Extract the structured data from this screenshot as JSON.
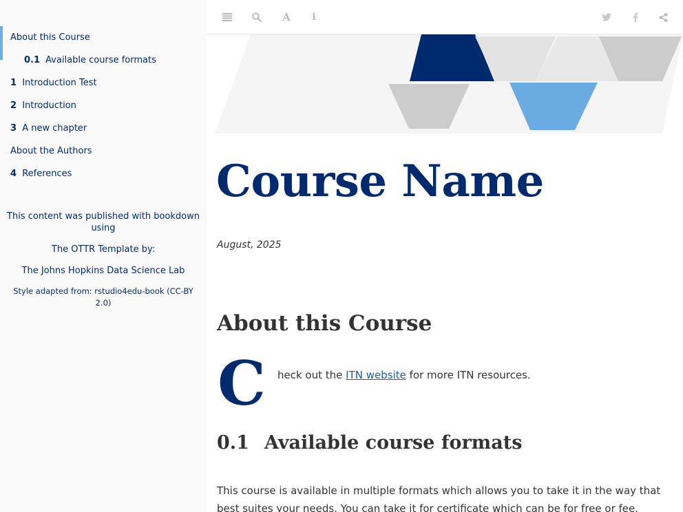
{
  "sidebar": {
    "toc": [
      {
        "num": "",
        "label": "About this Course",
        "level": 1,
        "active": true
      },
      {
        "num": "0.1",
        "label": "Available course formats",
        "level": 2
      },
      {
        "num": "1",
        "label": "Introduction Test",
        "level": 1
      },
      {
        "num": "2",
        "label": "Introduction",
        "level": 1
      },
      {
        "num": "3",
        "label": "A new chapter",
        "level": 1
      },
      {
        "num": "",
        "label": "About the Authors",
        "level": 1
      },
      {
        "num": "4",
        "label": "References",
        "level": 1
      }
    ],
    "published_note": "This content was published with bookdown using",
    "ottr_note": "The OTTR Template by:",
    "lab_note": "The Johns Hopkins Data Science Lab",
    "style_note": "Style adapted from: rstudio4edu-book (CC-BY 2.0)"
  },
  "toolbar": {
    "left_icons": [
      "sidebar-toggle-icon",
      "search-icon",
      "font-settings-icon",
      "info-icon"
    ],
    "right_icons": [
      "twitter-icon",
      "facebook-icon",
      "share-icon"
    ]
  },
  "main": {
    "title": "Course Name",
    "date": "August, 2025",
    "section_title": "About this Course",
    "dropcap": "C",
    "intro_before": "heck out the ",
    "intro_link": "ITN website",
    "intro_after": " for more ITN resources.",
    "sub_num": "0.1",
    "sub_title": "Available course formats",
    "formats_text": "This course is available in multiple formats which allows you to take it in the way that best suites your needs. You can take it for certificate which can be for free or fee."
  },
  "colors": {
    "brand_dark": "#002a6e",
    "accent_light": "#6fb0e4",
    "banner_gray": "#cccccc",
    "banner_light": "#e6e6e6"
  }
}
